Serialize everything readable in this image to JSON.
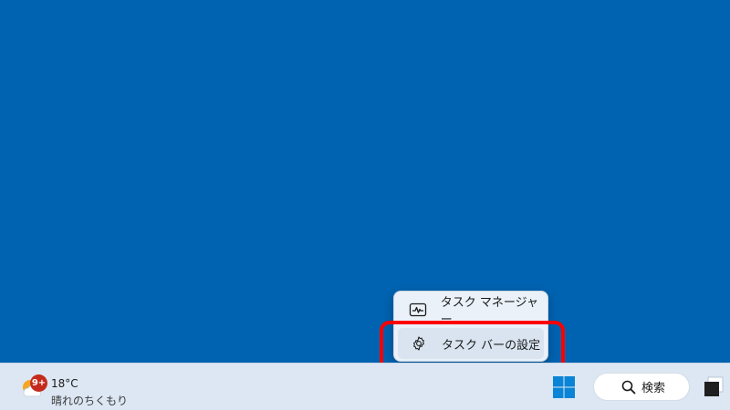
{
  "context_menu": {
    "items": [
      {
        "label": "タスク マネージャー",
        "icon": "task-manager-icon"
      },
      {
        "label": "タスク バーの設定",
        "icon": "gear-icon"
      }
    ]
  },
  "taskbar": {
    "weather": {
      "temperature": "18°C",
      "condition": "晴れのちくもり",
      "badge": "9+",
      "icon": "sun-cloud-icon"
    },
    "search": {
      "label": "検索",
      "icon": "search-icon"
    },
    "start_icon": "windows-logo-icon",
    "task_view_icon": "task-view-icon"
  },
  "colors": {
    "desktop": "#0063b1",
    "taskbar": "#dce7f3",
    "highlight": "#ff0000",
    "badge": "#c42b1c",
    "windows_logo": "#0a84d6"
  }
}
